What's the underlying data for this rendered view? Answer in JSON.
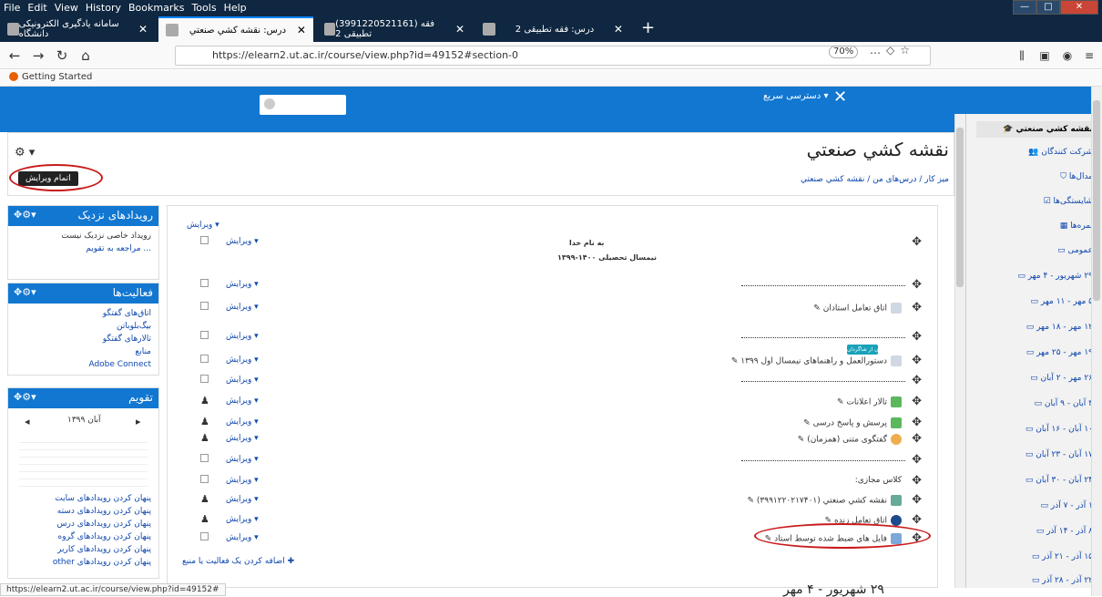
{
  "browser": {
    "menu": [
      "File",
      "Edit",
      "View",
      "History",
      "Bookmarks",
      "Tools",
      "Help"
    ],
    "tabs": [
      {
        "title": "سامانه یادگیری الکترونیکی دانشگاه"
      },
      {
        "title": "درس: نقشه کشي صنعتي"
      },
      {
        "title": "(3991220521161) فقه تطبیقی 2"
      },
      {
        "title": "درس: فقه تطبیقی 2"
      }
    ],
    "url": "https://elearn2.ut.ac.ir/course/view.php?id=49152#section-0",
    "zoom": "70%",
    "bookmark": "Getting Started",
    "status_url": "https://elearn2.ut.ac.ir/course/view.php?id=49152#"
  },
  "navbar": {
    "quick_access": "دسترسی سریع ▾"
  },
  "drawer": {
    "items": [
      {
        "label": "نقشه كشي صنعتي",
        "icon": "graduation-cap-icon",
        "active": true
      },
      {
        "label": "شرکت کنندگان",
        "icon": "users-icon"
      },
      {
        "label": "مدال‌ها",
        "icon": "shield-icon"
      },
      {
        "label": "شایستگی‌ها",
        "icon": "checkbox-icon"
      },
      {
        "label": "نمره‌ها",
        "icon": "table-icon"
      },
      {
        "label": "عمومی",
        "icon": "folder-icon"
      },
      {
        "label": "۲۹ شهریور - ۴ مهر",
        "icon": "folder-icon"
      },
      {
        "label": "۵ مهر - ۱۱ مهر",
        "icon": "folder-icon"
      },
      {
        "label": "۱۲ مهر - ۱۸ مهر",
        "icon": "folder-icon"
      },
      {
        "label": "۱۹ مهر - ۲۵ مهر",
        "icon": "folder-icon"
      },
      {
        "label": "۲۶ مهر - ۲ آبان",
        "icon": "folder-icon"
      },
      {
        "label": "۳ آبان - ۹ آبان",
        "icon": "folder-icon"
      },
      {
        "label": "۱۰ آبان - ۱۶ آبان",
        "icon": "folder-icon"
      },
      {
        "label": "۱۷ آبان - ۲۳ آبان",
        "icon": "folder-icon"
      },
      {
        "label": "۲۴ آبان - ۳۰ آبان",
        "icon": "folder-icon"
      },
      {
        "label": "۱ آذر - ۷ آذر",
        "icon": "folder-icon"
      },
      {
        "label": "۸ آذر - ۱۴ آذر",
        "icon": "folder-icon"
      },
      {
        "label": "۱۵ آذر - ۲۱ آذر",
        "icon": "folder-icon"
      },
      {
        "label": "۲۲ آذر - ۲۸ آذر",
        "icon": "folder-icon"
      }
    ]
  },
  "header": {
    "title": "نقشه كشي صنعتي",
    "breadcrumb": "میز کار / درس‌های من / نقشه کشي صنعتي",
    "edit_button": "اتمام ویرایش"
  },
  "blocks": {
    "upcoming": {
      "title": "رویدادهای نزدیک",
      "empty": "رویداد خاصی نزدیک نیست",
      "link": "... مراجعه به تقویم"
    },
    "activities": {
      "title": "فعالیت‌ها",
      "items": [
        "اتاق‌های گفتگو",
        "بیگ‌بلوباتن",
        "تالارهای گفتگو",
        "منابع",
        "Adobe Connect"
      ]
    },
    "calendar": {
      "title": "تقویم",
      "month": "آبان ۱۳۹۹",
      "hide_items": [
        "پنهان کردن رویدادهای سایت",
        "پنهان کردن رویدادهای دسته",
        "پنهان کردن رویدادهای درس",
        "پنهان کردن رویدادهای گروه",
        "پنهان کردن رویدادهای کاربر",
        "پنهان کردن رویدادهای other"
      ]
    }
  },
  "main": {
    "edit_label": "ویرایش",
    "section_edit": "ویرایش ▾",
    "heading1": "به نام خدا",
    "heading2": "نیمسال تحصیلی ۱۴۰۰-۱۳۹۹",
    "items": [
      {
        "name": "اتاق تعامل استادان",
        "hidden_badge": "پنهان از شاگردان"
      },
      {
        "name": "دستورالعمل و راهنماهای نیمسال اول ۱۳۹۹"
      },
      {
        "name": "تالار اعلانات"
      },
      {
        "name": "پرسش و پاسخ درسی"
      },
      {
        "name": "گفتگوی متنی (همزمان)"
      },
      {
        "name": "کلاس مجازی:"
      },
      {
        "name": "نقشه کشي صنعتي (۳۹۹۱۲۲۰۲۱۷۴۰۱)"
      },
      {
        "name": "اتاق تعامل زنده"
      },
      {
        "name": "فایل های ضبط شده توسط استاد"
      }
    ],
    "add_activity": "اضافه کردن یک فعالیت یا منبع",
    "next_section": "۲۹ شهریور - ۴ مهر"
  }
}
